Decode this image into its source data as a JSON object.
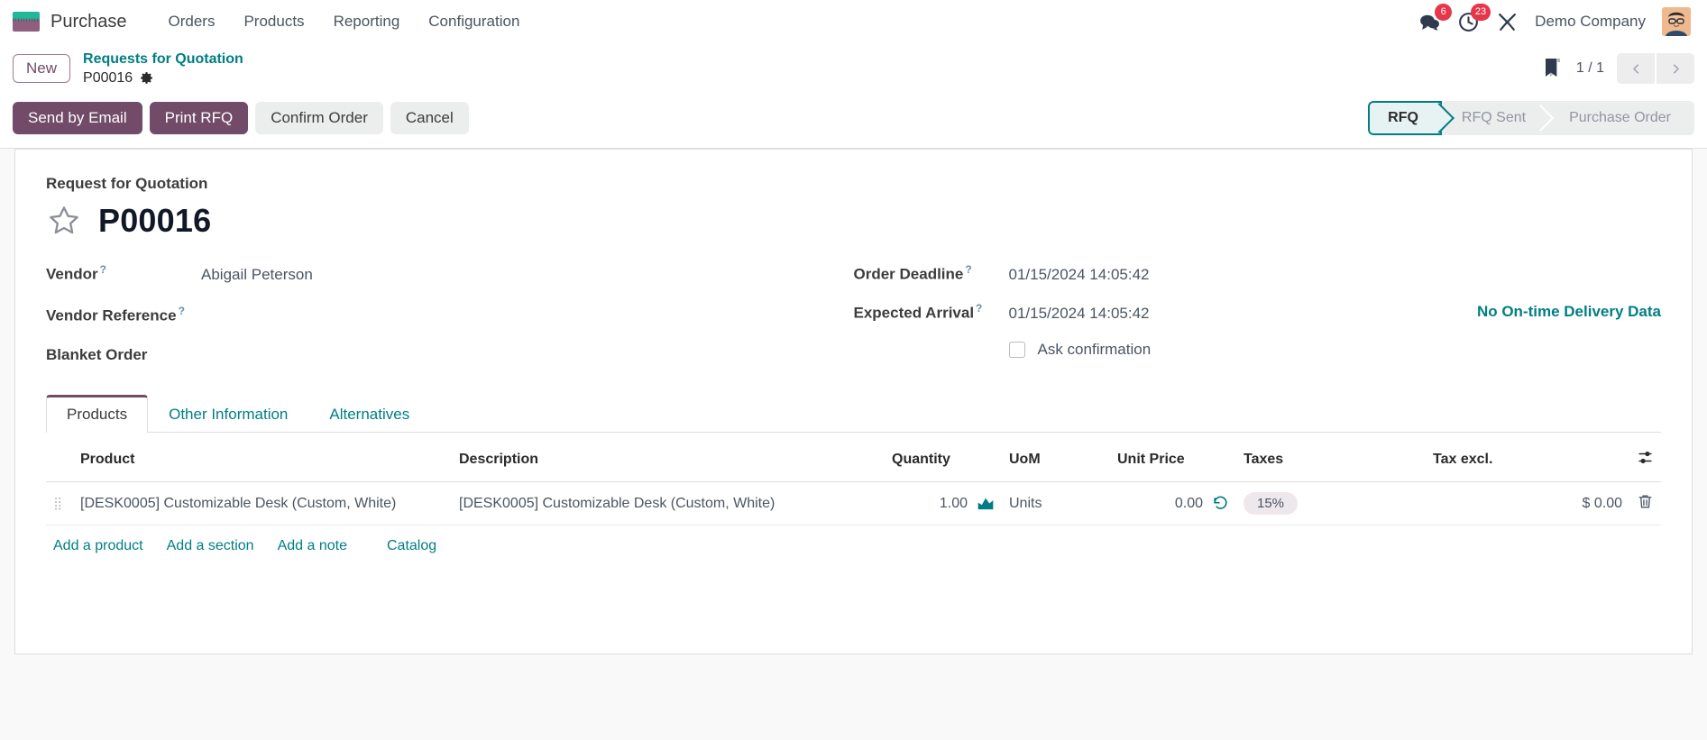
{
  "navbar": {
    "brand": "Purchase",
    "menu": [
      "Orders",
      "Products",
      "Reporting",
      "Configuration"
    ],
    "messages_count": "6",
    "activities_count": "23",
    "company": "Demo Company"
  },
  "controlpanel": {
    "new_label": "New",
    "breadcrumb_parent": "Requests for Quotation",
    "breadcrumb_current": "P00016",
    "pager": "1 / 1"
  },
  "actions": {
    "send_by_email": "Send by Email",
    "print_rfq": "Print RFQ",
    "confirm_order": "Confirm Order",
    "cancel": "Cancel"
  },
  "status": {
    "steps": [
      "RFQ",
      "RFQ Sent",
      "Purchase Order"
    ],
    "active_index": 0
  },
  "form": {
    "subtitle": "Request for Quotation",
    "record_id": "P00016",
    "left_fields": [
      {
        "label": "Vendor",
        "tooltip": "?",
        "value": "Abigail Peterson"
      },
      {
        "label": "Vendor Reference",
        "tooltip": "?",
        "value": ""
      },
      {
        "label": "Blanket Order",
        "tooltip": "",
        "value": ""
      }
    ],
    "right_fields": [
      {
        "label": "Order Deadline",
        "tooltip": "?",
        "value": "01/15/2024 14:05:42"
      },
      {
        "label": "Expected Arrival",
        "tooltip": "?",
        "value": "01/15/2024 14:05:42"
      }
    ],
    "ask_confirmation_label": "Ask confirmation",
    "ask_confirmation_checked": false,
    "delivery_note": "No On-time Delivery Data"
  },
  "tabs": {
    "items": [
      "Products",
      "Other Information",
      "Alternatives"
    ],
    "active_index": 0
  },
  "lines_table": {
    "headers": [
      "Product",
      "Description",
      "Quantity",
      "UoM",
      "Unit Price",
      "Taxes",
      "Tax excl."
    ],
    "rows": [
      {
        "product": "[DESK0005] Customizable Desk (Custom, White)",
        "description": "[DESK0005] Customizable Desk (Custom, White)",
        "quantity": "1.00",
        "uom": "Units",
        "unit_price": "0.00",
        "taxes": "15%",
        "tax_excl": "$ 0.00"
      }
    ],
    "add_links": [
      "Add a product",
      "Add a section",
      "Add a note"
    ],
    "catalog_link": "Catalog"
  },
  "colors": {
    "primary": "#714b67",
    "accent": "#017e84",
    "badge": "#e6364a",
    "tax_pill_bg": "#eee7ec"
  }
}
